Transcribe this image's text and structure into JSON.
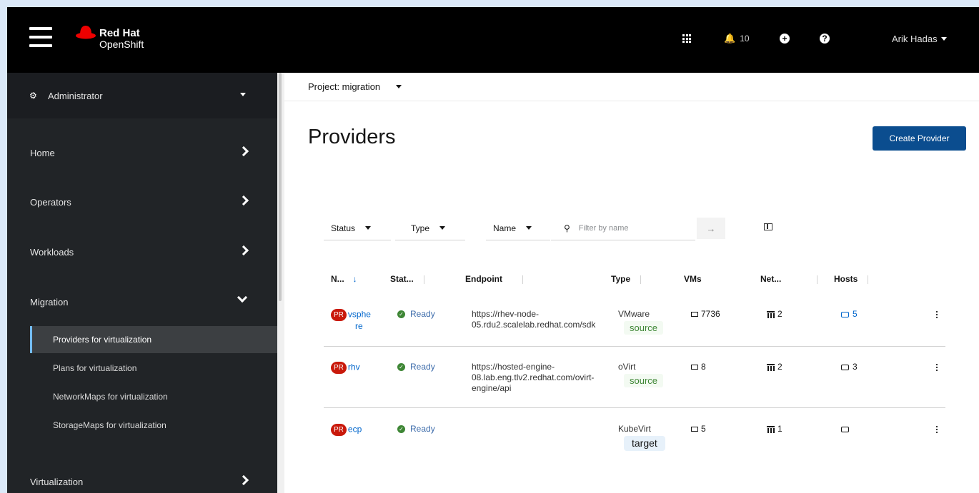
{
  "masthead": {
    "brand_line1": "Red Hat",
    "brand_line2": "OpenShift",
    "notification_count": "10",
    "user": "Arik Hadas"
  },
  "sidebar": {
    "perspective": "Administrator",
    "items": [
      {
        "label": "Home"
      },
      {
        "label": "Operators"
      },
      {
        "label": "Workloads"
      },
      {
        "label": "Migration"
      },
      {
        "label": "Virtualization"
      }
    ],
    "migration_subitems": [
      {
        "label": "Providers for virtualization",
        "active": true
      },
      {
        "label": "Plans for virtualization"
      },
      {
        "label": "NetworkMaps for virtualization"
      },
      {
        "label": "StorageMaps for virtualization"
      }
    ]
  },
  "project": {
    "label": "Project: migration"
  },
  "page": {
    "title": "Providers",
    "create_button": "Create Provider"
  },
  "toolbar": {
    "status_filter": "Status",
    "type_filter": "Type",
    "name_filter": "Name",
    "search_placeholder": "Filter by name"
  },
  "table": {
    "columns": [
      "N...",
      "Stat...",
      "Endpoint",
      "Type",
      "VMs",
      "Net...",
      "Hosts"
    ],
    "rows": [
      {
        "badge": "PR",
        "name_line1": "vsphe",
        "name_line2": "re",
        "status": "Ready",
        "endpoint_lines": [
          "https://rhev-node-",
          "05.rdu2.scalelab.redhat.com/sdk"
        ],
        "type": "VMware",
        "role": "source",
        "vms": "7736",
        "networks": "2",
        "hosts": "5"
      },
      {
        "badge": "PR",
        "name_line1": "rhv",
        "name_line2": "",
        "status": "Ready",
        "endpoint_lines": [
          "https://hosted-engine-",
          "08.lab.eng.tlv2.redhat.com/ovirt-",
          "engine/api"
        ],
        "type": "oVirt",
        "role": "source",
        "vms": "8",
        "networks": "2",
        "hosts": "3"
      },
      {
        "badge": "PR",
        "name_line1": "ecp",
        "name_line2": "",
        "status": "Ready",
        "endpoint_lines": [],
        "type": "KubeVirt",
        "role": "target",
        "vms": "5",
        "networks": "1",
        "hosts": ""
      }
    ]
  }
}
